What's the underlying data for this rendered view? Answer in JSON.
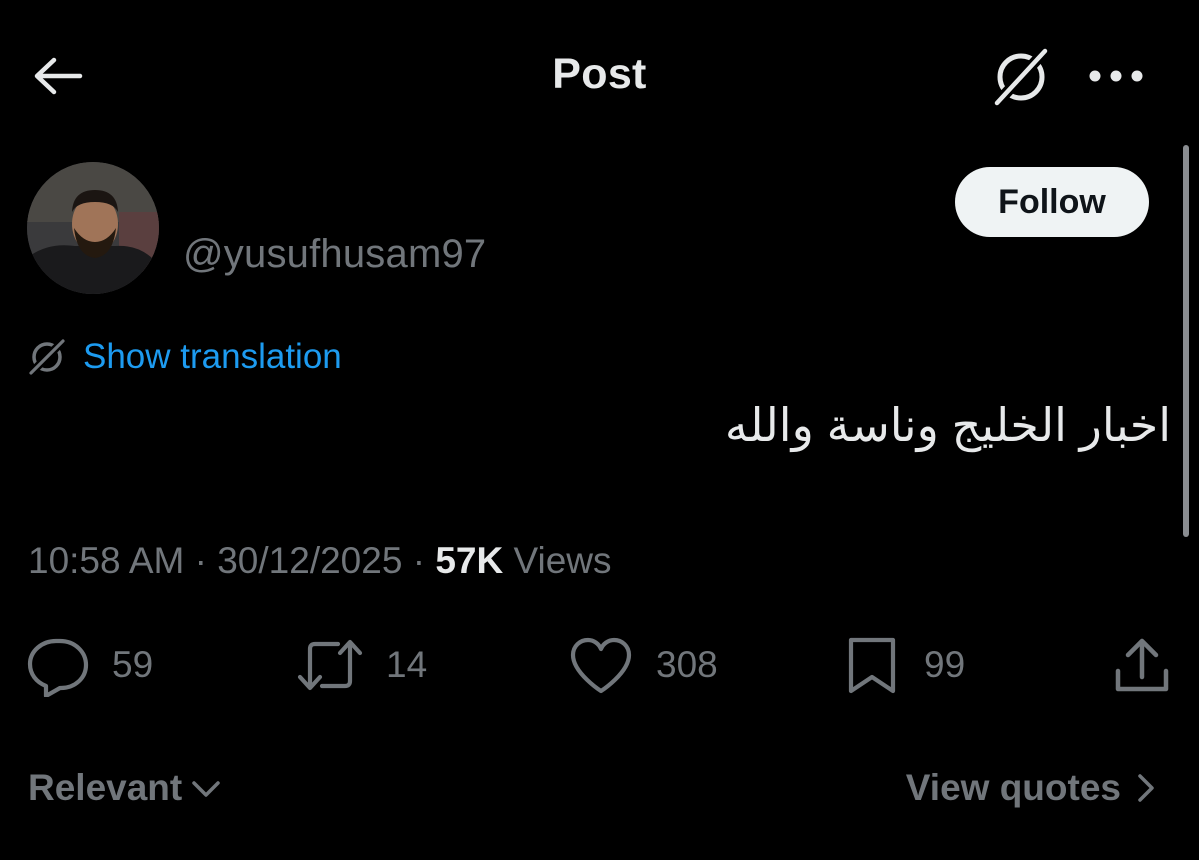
{
  "header": {
    "title": "Post",
    "back_icon": "arrow-left-icon",
    "grok_icon": "grok-icon",
    "more_icon": "more-horizontal-icon"
  },
  "author": {
    "handle": "@yusufhusam97",
    "follow_label": "Follow"
  },
  "post": {
    "translate_label": "Show translation",
    "text": "اخبار الخليج وناسة والله",
    "time": "10:58 AM",
    "separator": " · ",
    "date": "30/12/2025",
    "views_count": "57K",
    "views_label": "Views"
  },
  "actions": {
    "replies": "59",
    "reposts": "14",
    "likes": "308",
    "bookmarks": "99"
  },
  "footer": {
    "sort_label": "Relevant",
    "quotes_label": "View quotes"
  },
  "colors": {
    "background": "#000000",
    "primary_text": "#e7e9ea",
    "secondary_text": "#71767b",
    "link": "#1d9bf0",
    "follow_bg": "#eff3f4"
  }
}
